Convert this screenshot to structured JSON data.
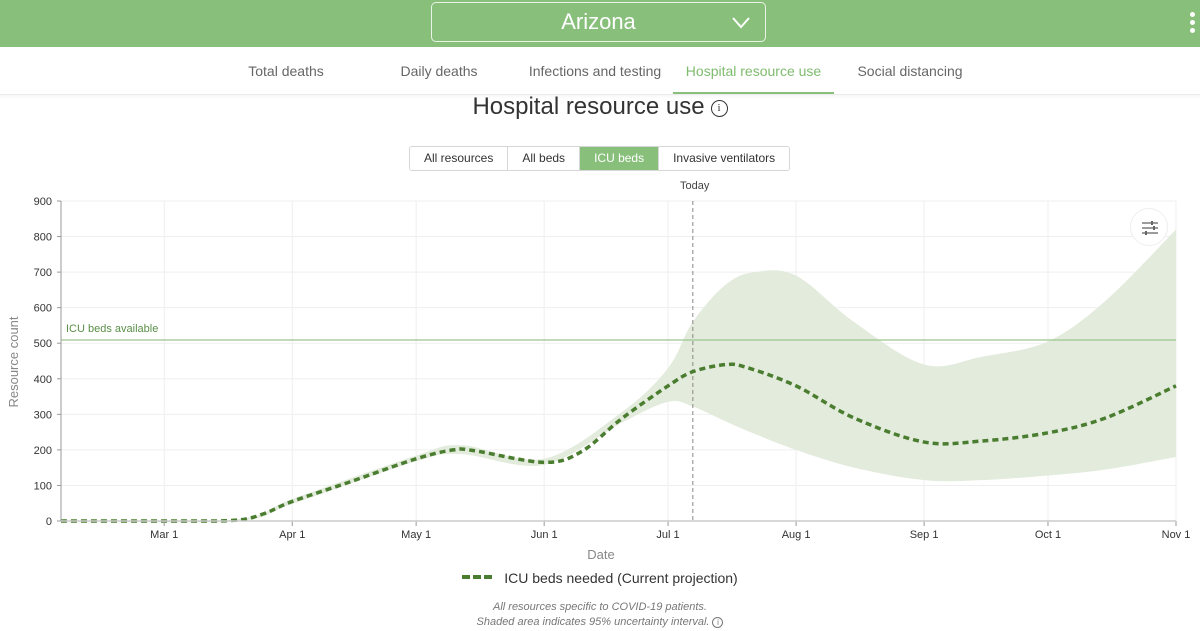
{
  "header": {
    "location": "Arizona",
    "location_chevron_icon": "chevron-down-icon",
    "menu_icon": "kebab-menu-icon"
  },
  "tabs": [
    {
      "label": "Total deaths",
      "active": false
    },
    {
      "label": "Daily deaths",
      "active": false
    },
    {
      "label": "Infections and testing",
      "active": false
    },
    {
      "label": "Hospital resource use",
      "active": true
    },
    {
      "label": "Social distancing",
      "active": false
    }
  ],
  "page_title": "Hospital resource use",
  "title_info_icon": "info-icon",
  "resource_filters": [
    {
      "label": "All resources",
      "active": false
    },
    {
      "label": "All beds",
      "active": false
    },
    {
      "label": "ICU beds",
      "active": true
    },
    {
      "label": "Invasive ventilators",
      "active": false
    }
  ],
  "settings_icon": "sliders-icon",
  "legend": {
    "label": "ICU beds needed (Current projection)"
  },
  "footnote": {
    "line1": "All resources specific to COVID-19 patients.",
    "line2": "Shaded area indicates 95% uncertainty interval."
  },
  "colors": {
    "brand_green": "#88bf7b",
    "line_green": "#4a7d2f",
    "band_green": "#e2ebdc",
    "capacity_green": "#9cc58e"
  },
  "chart_data": {
    "type": "line",
    "title": "Hospital resource use",
    "xlabel": "Date",
    "ylabel": "Resource count",
    "ylim": [
      0,
      900
    ],
    "yticks": [
      0,
      100,
      200,
      300,
      400,
      500,
      600,
      700,
      800,
      900
    ],
    "xlim": [
      "Feb 4",
      "Nov 1"
    ],
    "xticks": [
      "Mar 1",
      "Apr 1",
      "May 1",
      "Jun 1",
      "Jul 1",
      "Aug 1",
      "Sep 1",
      "Oct 1",
      "Nov 1"
    ],
    "grid": true,
    "legend_position": "bottom",
    "today_label": "Today",
    "today_date": "Jul 7",
    "reference_line": {
      "label": "ICU beds available",
      "value": 509
    },
    "series": [
      {
        "name": "ICU beds needed (Current projection)",
        "style": "dashed",
        "x": [
          "Feb 4",
          "Mar 1",
          "Mar 18",
          "Mar 25",
          "Apr 1",
          "Apr 15",
          "May 1",
          "May 10",
          "May 15",
          "Jun 1",
          "Jun 10",
          "Jun 20",
          "Jul 1",
          "Jul 7",
          "Jul 15",
          "Jul 20",
          "Aug 1",
          "Aug 15",
          "Sep 1",
          "Sep 15",
          "Oct 1",
          "Oct 15",
          "Nov 1"
        ],
        "values": [
          0,
          0,
          2,
          20,
          55,
          110,
          175,
          200,
          198,
          165,
          195,
          290,
          380,
          420,
          440,
          432,
          380,
          290,
          222,
          225,
          248,
          290,
          380
        ]
      }
    ],
    "uncertainty_band": {
      "name": "95% uncertainty interval",
      "x": [
        "Feb 4",
        "Mar 18",
        "Apr 1",
        "May 1",
        "May 12",
        "Jun 1",
        "Jun 20",
        "Jul 1",
        "Jul 7",
        "Jul 15",
        "Jul 22",
        "Aug 1",
        "Aug 15",
        "Sep 1",
        "Sep 15",
        "Oct 1",
        "Oct 15",
        "Nov 1"
      ],
      "upper": [
        0,
        4,
        62,
        184,
        213,
        175,
        308,
        430,
        560,
        665,
        700,
        690,
        560,
        440,
        462,
        505,
        620,
        820
      ],
      "lower": [
        0,
        0,
        48,
        168,
        188,
        158,
        278,
        335,
        322,
        280,
        245,
        200,
        150,
        115,
        115,
        128,
        145,
        180
      ]
    }
  }
}
